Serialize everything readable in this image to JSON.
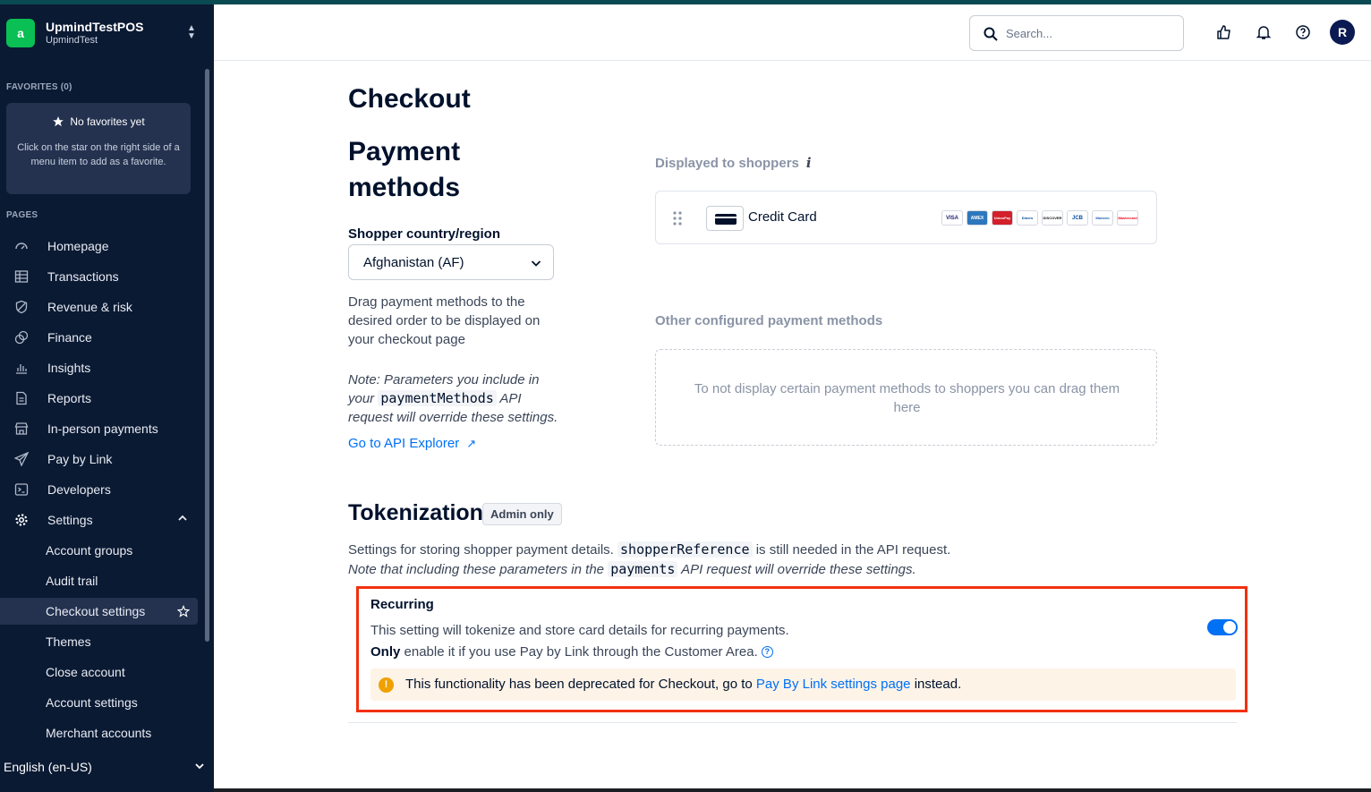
{
  "account": {
    "logo_letter": "a",
    "name": "UpmindTestPOS",
    "sub": "UpmindTest"
  },
  "favorites": {
    "section_label": "FAVORITES (0)",
    "title": "No favorites yet",
    "text": "Click on the star on the right side of a menu item to add as a favorite."
  },
  "pages_label": "PAGES",
  "nav": [
    {
      "label": "Homepage",
      "icon": "gauge-icon"
    },
    {
      "label": "Transactions",
      "icon": "table-icon"
    },
    {
      "label": "Revenue & risk",
      "icon": "shield-icon"
    },
    {
      "label": "Finance",
      "icon": "coins-icon"
    },
    {
      "label": "Insights",
      "icon": "bar-chart-icon"
    },
    {
      "label": "Reports",
      "icon": "document-icon"
    },
    {
      "label": "In-person payments",
      "icon": "store-icon"
    },
    {
      "label": "Pay by Link",
      "icon": "paper-plane-icon"
    },
    {
      "label": "Developers",
      "icon": "terminal-icon"
    },
    {
      "label": "Settings",
      "icon": "gear-icon"
    }
  ],
  "settings_sub": [
    "Account groups",
    "Audit trail",
    "Checkout settings",
    "Themes",
    "Close account",
    "Account settings",
    "Merchant accounts"
  ],
  "language": "English (en-US)",
  "header": {
    "search_placeholder": "Search...",
    "avatar_letter": "R"
  },
  "page": {
    "title": "Checkout",
    "payment_methods_title": "Payment methods",
    "country_label": "Shopper country/region",
    "country_value": "Afghanistan (AF)",
    "drag_help": "Drag payment methods to the desired order to be displayed on your checkout page",
    "note_prefix": "Note: Parameters you include in your",
    "note_code": "paymentMethods",
    "note_suffix": "API request will override these settings.",
    "api_link": "Go to API Explorer",
    "displayed_label": "Displayed to shoppers",
    "displayed_method": "Credit Card",
    "card_brands": [
      "VISA",
      "AMEX",
      "UnionPay",
      "Diners",
      "DISCOVER",
      "JCB",
      "Maestro",
      "Mastercard"
    ],
    "other_label": "Other configured payment methods",
    "drop_text": "To not display certain payment methods to shoppers you can drag them here"
  },
  "tokenization": {
    "title": "Tokenization",
    "badge": "Admin only",
    "desc1_prefix": "Settings for storing shopper payment details.",
    "desc1_code": "shopperReference",
    "desc1_suffix": "is still needed in the API request.",
    "desc2_prefix": "Note that including these parameters in the",
    "desc2_code": "payments",
    "desc2_suffix": "API request will override these settings.",
    "recurring": {
      "title": "Recurring",
      "line1": "This setting will tokenize and store card details for recurring payments.",
      "line2_bold": "Only",
      "line2_rest": "enable it if you use Pay by Link through the Customer Area.",
      "enabled": true,
      "warn_prefix": "This functionality has been deprecated for Checkout, go to",
      "warn_link": "Pay By Link settings page",
      "warn_suffix": "instead."
    }
  },
  "colors": {
    "sidebar_bg": "#0b1a33",
    "accent_blue": "#0070f5",
    "highlight_red": "#f2300f",
    "warning_orange": "#f0a000",
    "brand_green": "#0abf53"
  }
}
